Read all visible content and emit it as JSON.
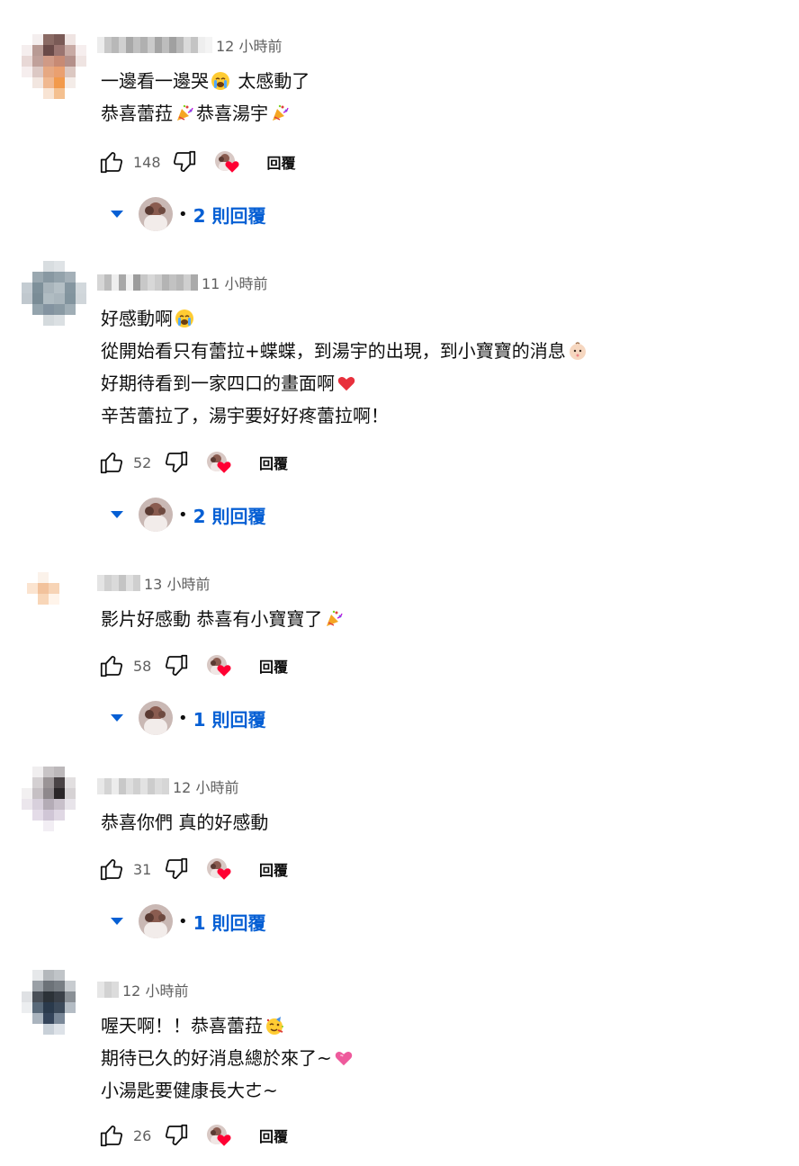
{
  "ui": {
    "reply_label": "回覆",
    "replies_dot": "•"
  },
  "colors": {
    "link_blue": "#065fd4",
    "secondary_text": "#606060",
    "heart_red": "#ff0033"
  },
  "comments": [
    {
      "time": "12 小時前",
      "lines": [
        "一邊看一邊哭😭 太感動了",
        "恭喜蕾菈🎉恭喜湯宇🎉"
      ],
      "likes": "148",
      "replies_text": "2 則回覆"
    },
    {
      "time": "11 小時前",
      "lines": [
        "好感動啊😭",
        "從開始看只有蕾拉+蝶蝶，到湯宇的出現，到小寶寶的消息👶🏻",
        "好期待看到一家四口的畫面啊❤️",
        "辛苦蕾拉了，湯宇要好好疼蕾拉啊！"
      ],
      "likes": "52",
      "replies_text": "2 則回覆"
    },
    {
      "time": "13 小時前",
      "lines": [
        "影片好感動 恭喜有小寶寶了🎉"
      ],
      "likes": "58",
      "replies_text": "1 則回覆"
    },
    {
      "time": "12 小時前",
      "lines": [
        "恭喜你們 真的好感動"
      ],
      "likes": "31",
      "replies_text": "1 則回覆"
    },
    {
      "time": "12 小時前",
      "lines": [
        "喔天啊！！恭喜蕾菈🥳",
        "期待已久的好消息總於來了~💗",
        "小湯匙要健康長大ㄜ~"
      ],
      "likes": "26",
      "replies_text": ""
    }
  ]
}
